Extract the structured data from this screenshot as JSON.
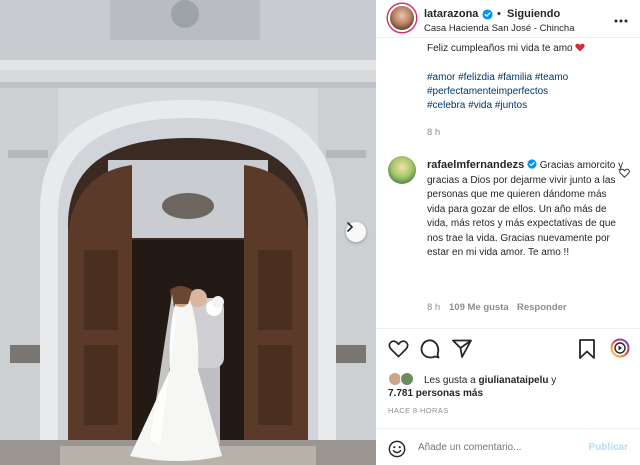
{
  "post": {
    "author": "latarazona",
    "follow_separator": "•",
    "follow_label": "Siguiendo",
    "location": "Casa Hacienda San José - Chincha"
  },
  "caption": {
    "text": "Feliz cumpleaños mi vida te amo",
    "hashtags_line1": "#amor #felizdia #familia #teamo",
    "hashtags_line2": "#perfectamenteimperfectos",
    "hashtags_line3": "#celebra #vida #juntos",
    "time": "8 h"
  },
  "comment": {
    "author": "rafaelmfernandezs",
    "text": "Gracias amorcito y gracias a Dios por dejarme vivir junto a las personas que me quieren dándome más vida para gozar de ellos. Un año más de vida, más retos y más expectativas de que nos trae la vida. Gracias nuevamente por estar en mi vida amor. Te amo !!",
    "time": "8 h",
    "likes": "109 Me gusta",
    "reply": "Responder"
  },
  "likes": {
    "prefix": "Les gusta a",
    "user": "giulianataipelu",
    "conj": "y",
    "others": "7.781 personas más"
  },
  "timestamp": "HACE 8 HORAS",
  "add_comment": {
    "placeholder": "Añade un comentario...",
    "post_label": "Publicar"
  },
  "colors": {
    "verified": "#0095f6",
    "hashtag": "#00376b",
    "secondary_text": "#8e8e8e",
    "heart": "#ed4956"
  }
}
